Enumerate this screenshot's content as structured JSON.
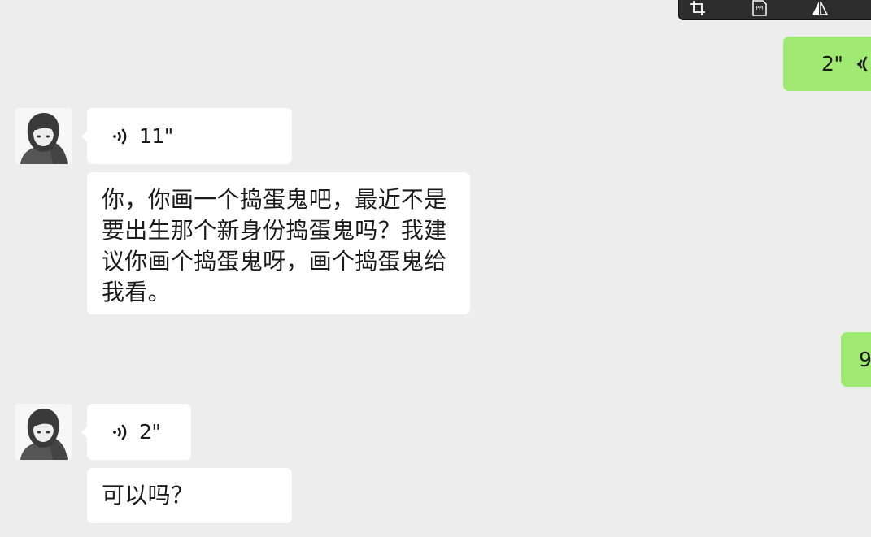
{
  "toolbar": {
    "tools": [
      {
        "name": "crop-icon"
      },
      {
        "name": "ppi-icon",
        "label": "PPI"
      },
      {
        "name": "flip-icon"
      }
    ]
  },
  "messages": [
    {
      "id": "m1",
      "side": "right",
      "type": "voice",
      "duration": "2\""
    },
    {
      "id": "m2",
      "side": "left",
      "type": "voice",
      "duration": "11\""
    },
    {
      "id": "m3",
      "side": "left",
      "type": "text",
      "text": "你，你画一个捣蛋鬼吧，最近不是要出生那个新身份捣蛋鬼吗？我建议你画个捣蛋鬼呀，画个捣蛋鬼给我看。"
    },
    {
      "id": "m4",
      "side": "right",
      "type": "voice",
      "duration": "9"
    },
    {
      "id": "m5",
      "side": "left",
      "type": "voice",
      "duration": "2\""
    },
    {
      "id": "m6",
      "side": "left",
      "type": "text",
      "text": "可以吗？"
    }
  ],
  "colors": {
    "background": "#ededed",
    "incoming_bubble": "#ffffff",
    "outgoing_bubble": "#a0ea73",
    "text": "#1a1a1a"
  }
}
